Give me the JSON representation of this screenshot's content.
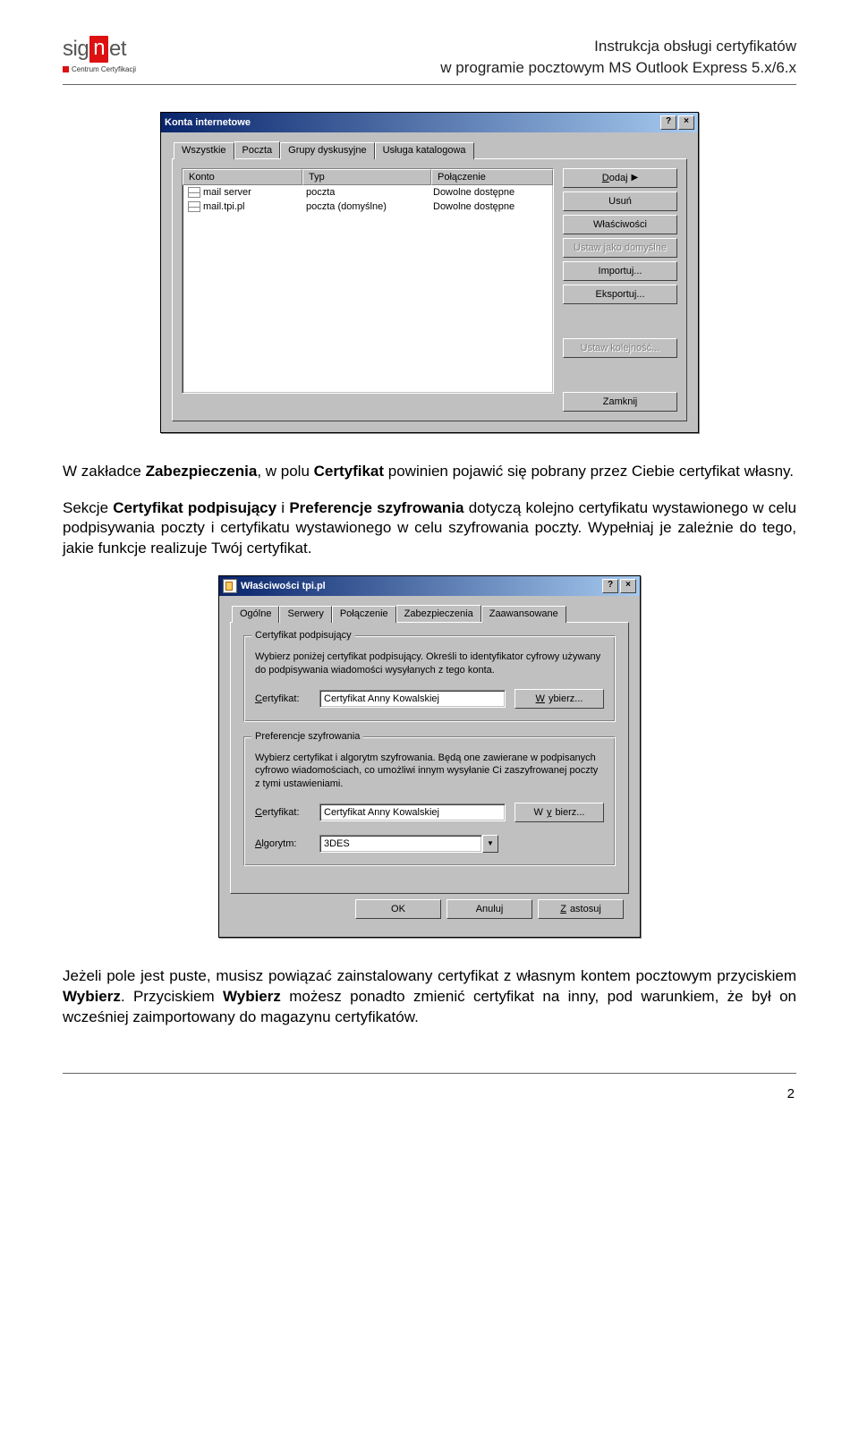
{
  "header": {
    "logo_text1": "sig",
    "logo_text2": "n",
    "logo_text3": "et",
    "logo_sub": "Centrum Certyfikacji",
    "title_line1": "Instrukcja obsługi certyfikatów",
    "title_line2": "w programie pocztowym MS Outlook Express 5.x/6.x"
  },
  "paragraphs": {
    "p1_a": "W zakładce ",
    "p1_b1": "Zabezpieczenia",
    "p1_c": ", w polu ",
    "p1_b2": "Certyfikat",
    "p1_d": " powinien pojawić się pobrany przez Ciebie certyfikat własny.",
    "p2_a": "Sekcje ",
    "p2_b1": "Certyfikat podpisujący",
    "p2_c": " i ",
    "p2_b2": "Preferencje szyfrowania",
    "p2_d": " dotyczą kolejno certyfikatu wystawionego w celu podpisywania poczty i certyfikatu wystawionego w celu szyfrowania poczty. Wypełniaj je zależnie do tego, jakie funkcje realizuje Twój certyfikat.",
    "p3_a": "Jeżeli pole jest puste, musisz powiązać zainstalowany certyfikat z własnym kontem pocztowym przyciskiem ",
    "p3_b1": "Wybierz",
    "p3_c": ". Przyciskiem ",
    "p3_b2": "Wybierz",
    "p3_d": " możesz ponadto zmienić certyfikat na inny, pod warunkiem, że był on wcześniej zaimportowany do magazynu certyfikatów."
  },
  "accounts_dialog": {
    "title": "Konta internetowe",
    "tabs": [
      "Wszystkie",
      "Poczta",
      "Grupy dyskusyjne",
      "Usługa katalogowa"
    ],
    "active_tab": 1,
    "columns": [
      "Konto",
      "Typ",
      "Połączenie"
    ],
    "rows": [
      {
        "name": "mail server",
        "type": "poczta",
        "conn": "Dowolne dostępne"
      },
      {
        "name": "mail.tpi.pl",
        "type": "poczta (domyślne)",
        "conn": "Dowolne dostępne"
      }
    ],
    "buttons": {
      "add": "Dodaj",
      "remove": "Usuń",
      "properties": "Właściwości",
      "set_default": "Ustaw jako domyślne",
      "import": "Importuj...",
      "export": "Eksportuj...",
      "order": "Ustaw kolejność...",
      "close": "Zamknij"
    }
  },
  "props_dialog": {
    "title": "Właściwości tpi.pl",
    "tabs": [
      "Ogólne",
      "Serwery",
      "Połączenie",
      "Zabezpieczenia",
      "Zaawansowane"
    ],
    "active_tab": 3,
    "group_sign": {
      "legend": "Certyfikat podpisujący",
      "desc": "Wybierz poniżej certyfikat podpisujący. Określi to identyfikator cyfrowy używany do podpisywania wiadomości wysyłanych z tego konta.",
      "field_label": "Certyfikat:",
      "field_value": "Certyfikat Anny Kowalskiej",
      "choose": "Wybierz..."
    },
    "group_enc": {
      "legend": "Preferencje szyfrowania",
      "desc": "Wybierz certyfikat i algorytm szyfrowania. Będą one zawierane w podpisanych cyfrowo wiadomościach, co umożliwi innym wysyłanie Ci zaszyfrowanej poczty z tymi ustawieniami.",
      "field_label": "Certyfikat:",
      "field_value": "Certyfikat Anny Kowalskiej",
      "choose": "Wybierz...",
      "algo_label": "Algorytm:",
      "algo_value": "3DES"
    },
    "buttons": {
      "ok": "OK",
      "cancel": "Anuluj",
      "apply": "Zastosuj"
    }
  },
  "pagenum": "2"
}
